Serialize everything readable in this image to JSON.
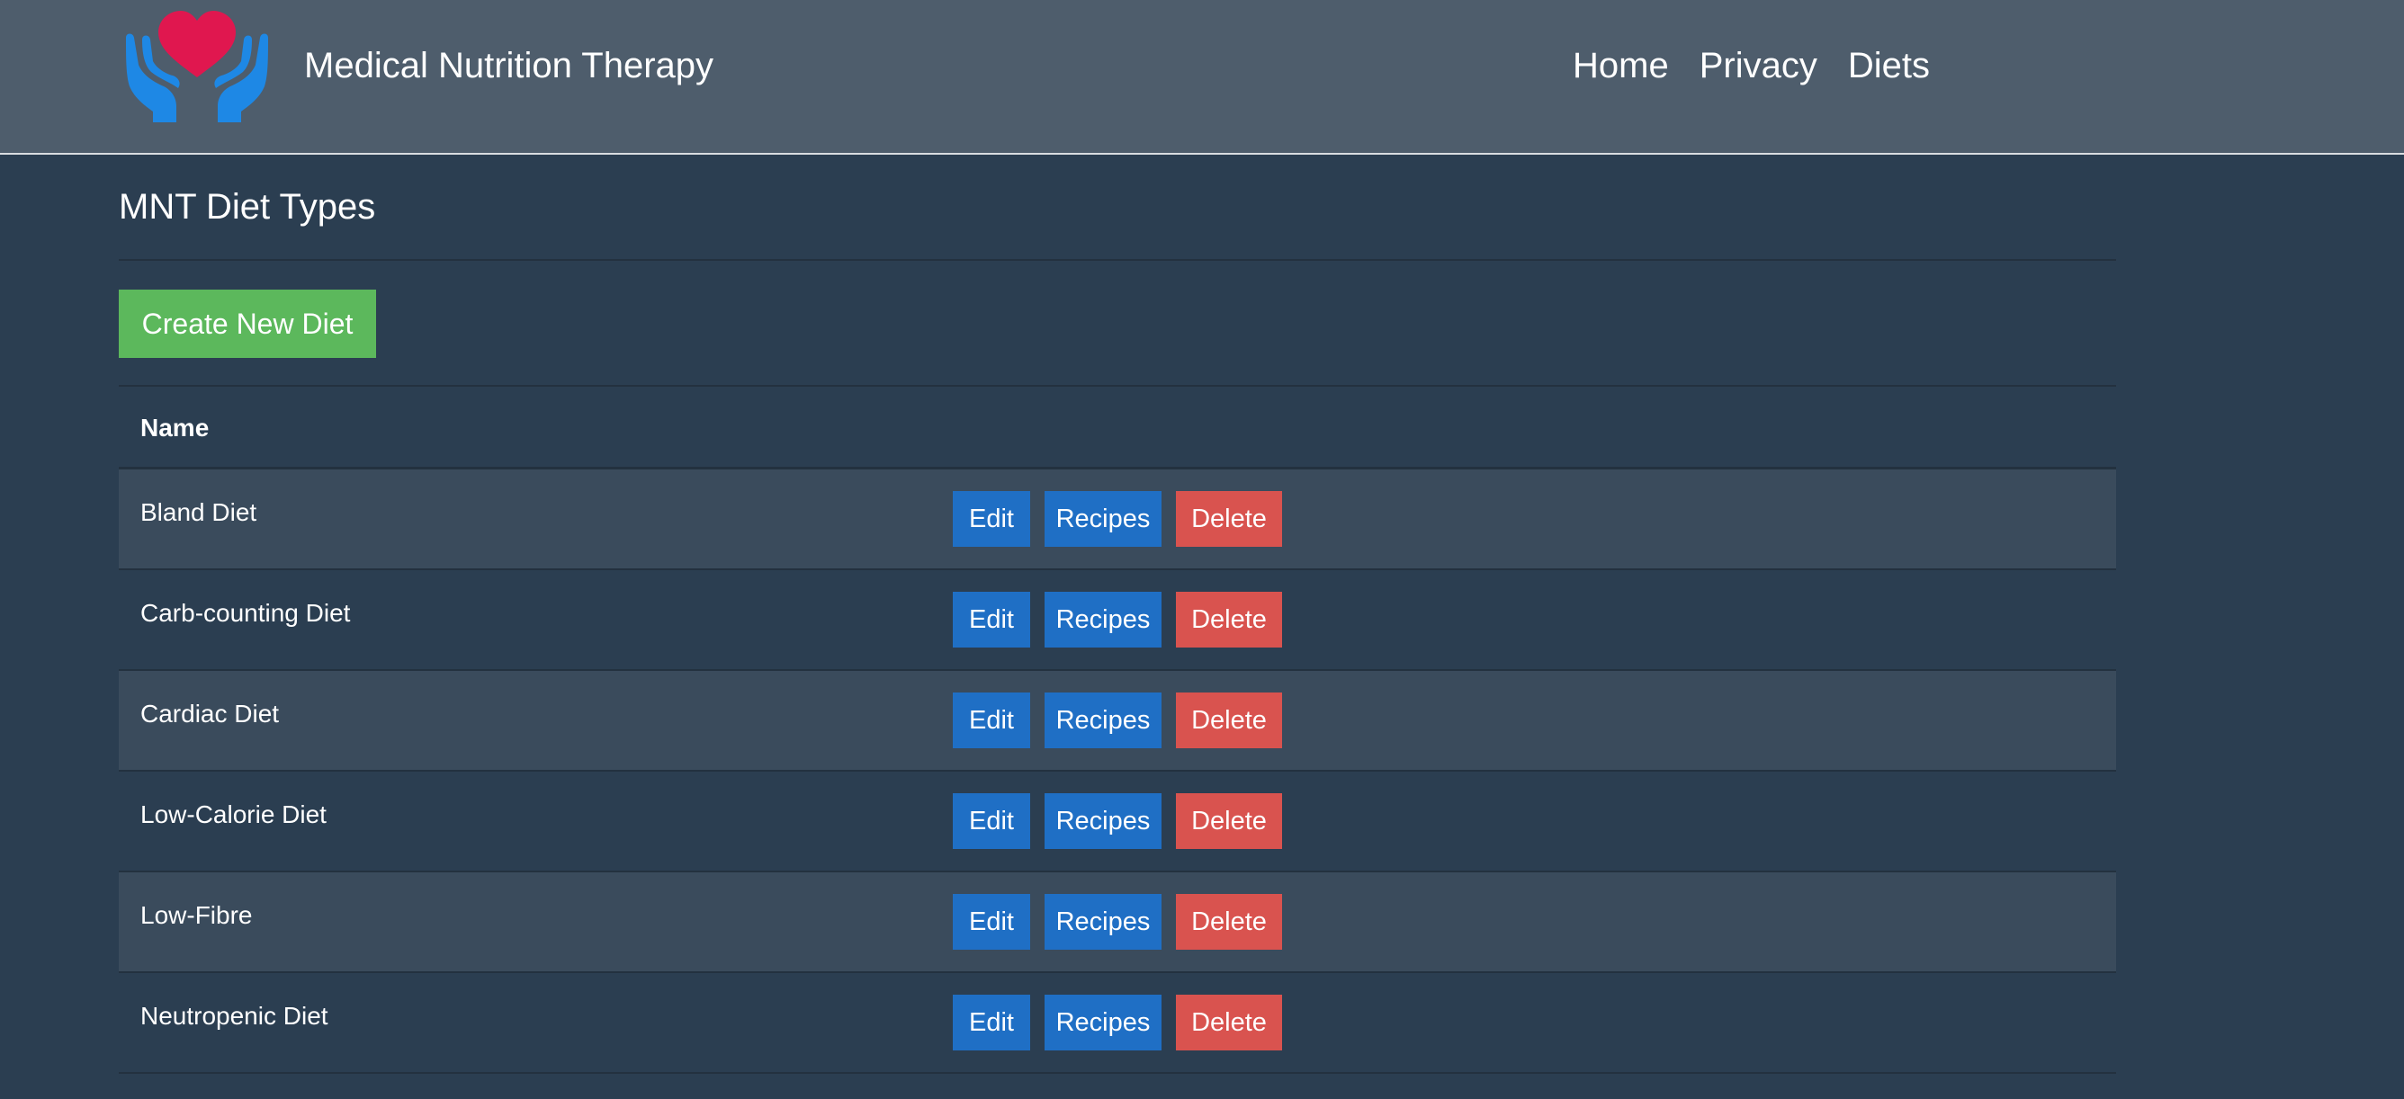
{
  "header": {
    "brand_title": "Medical Nutrition Therapy",
    "logo_icon": "heart-in-hands-icon",
    "nav": [
      {
        "label": "Home"
      },
      {
        "label": "Privacy"
      },
      {
        "label": "Diets"
      }
    ]
  },
  "main": {
    "page_title": "MNT Diet Types",
    "create_button_label": "Create New Diet",
    "table": {
      "column_name_header": "Name",
      "rows": [
        {
          "name": "Bland Diet",
          "edit": "Edit",
          "recipes": "Recipes",
          "delete": "Delete"
        },
        {
          "name": "Carb-counting Diet",
          "edit": "Edit",
          "recipes": "Recipes",
          "delete": "Delete"
        },
        {
          "name": "Cardiac Diet",
          "edit": "Edit",
          "recipes": "Recipes",
          "delete": "Delete"
        },
        {
          "name": "Low-Calorie Diet",
          "edit": "Edit",
          "recipes": "Recipes",
          "delete": "Delete"
        },
        {
          "name": "Low-Fibre",
          "edit": "Edit",
          "recipes": "Recipes",
          "delete": "Delete"
        },
        {
          "name": "Neutropenic Diet",
          "edit": "Edit",
          "recipes": "Recipes",
          "delete": "Delete"
        }
      ]
    }
  },
  "colors": {
    "navbar": "#4e5d6c",
    "page_background": "#2b3e51",
    "stripe_row": "#3a4b5c",
    "primary_button": "#1f6fc5",
    "success_button": "#5cb85c",
    "danger_button": "#d9534f",
    "heart": "#e0174f",
    "hands": "#1e88e5"
  }
}
